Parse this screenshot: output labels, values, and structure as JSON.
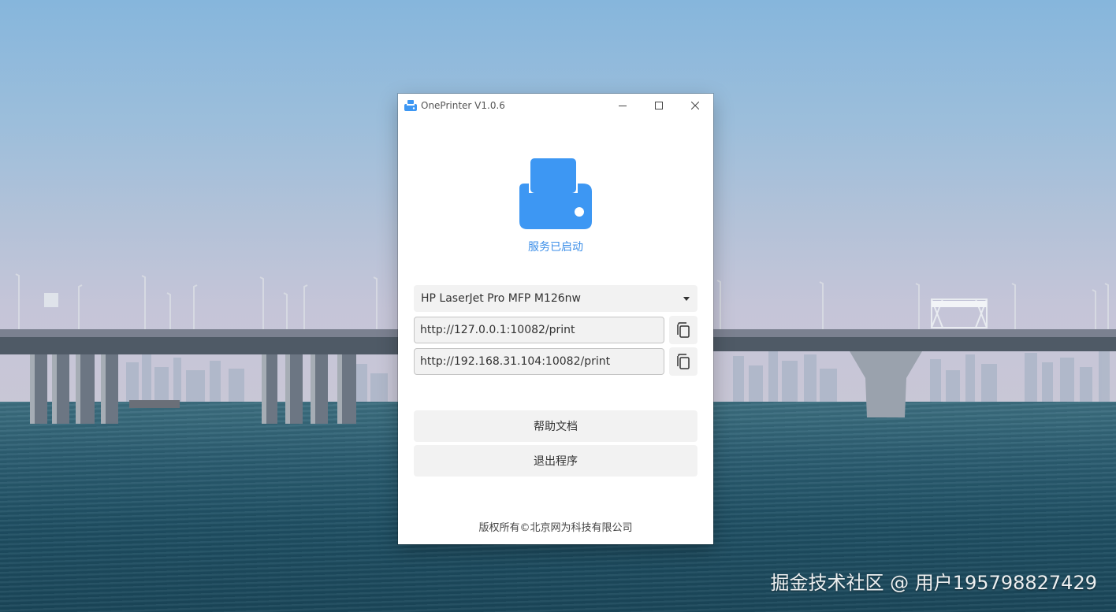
{
  "window": {
    "title": "OnePrinter V1.0.6",
    "app_icon": "printer-icon",
    "controls": [
      "minimize-icon",
      "maximize-icon",
      "close-icon"
    ]
  },
  "main": {
    "hero_icon": "printer-icon",
    "status": "服务已启动",
    "printer_select": {
      "selected": "HP LaserJet Pro MFP M126nw",
      "icon": "chevron-down-icon"
    },
    "urls": [
      {
        "value": "http://127.0.0.1:10082/print",
        "copy_icon": "copy-icon"
      },
      {
        "value": "http://192.168.31.104:10082/print",
        "copy_icon": "copy-icon"
      }
    ],
    "buttons": {
      "help": "帮助文档",
      "exit": "退出程序"
    },
    "copyright": "版权所有©北京网为科技有限公司"
  },
  "desktop": {
    "watermark": "掘金技术社区 @ 用户195798827429"
  },
  "colors": {
    "accent": "#3b8ee8",
    "icon_blue": "#3d97f3",
    "control_bg": "#f2f2f2"
  }
}
